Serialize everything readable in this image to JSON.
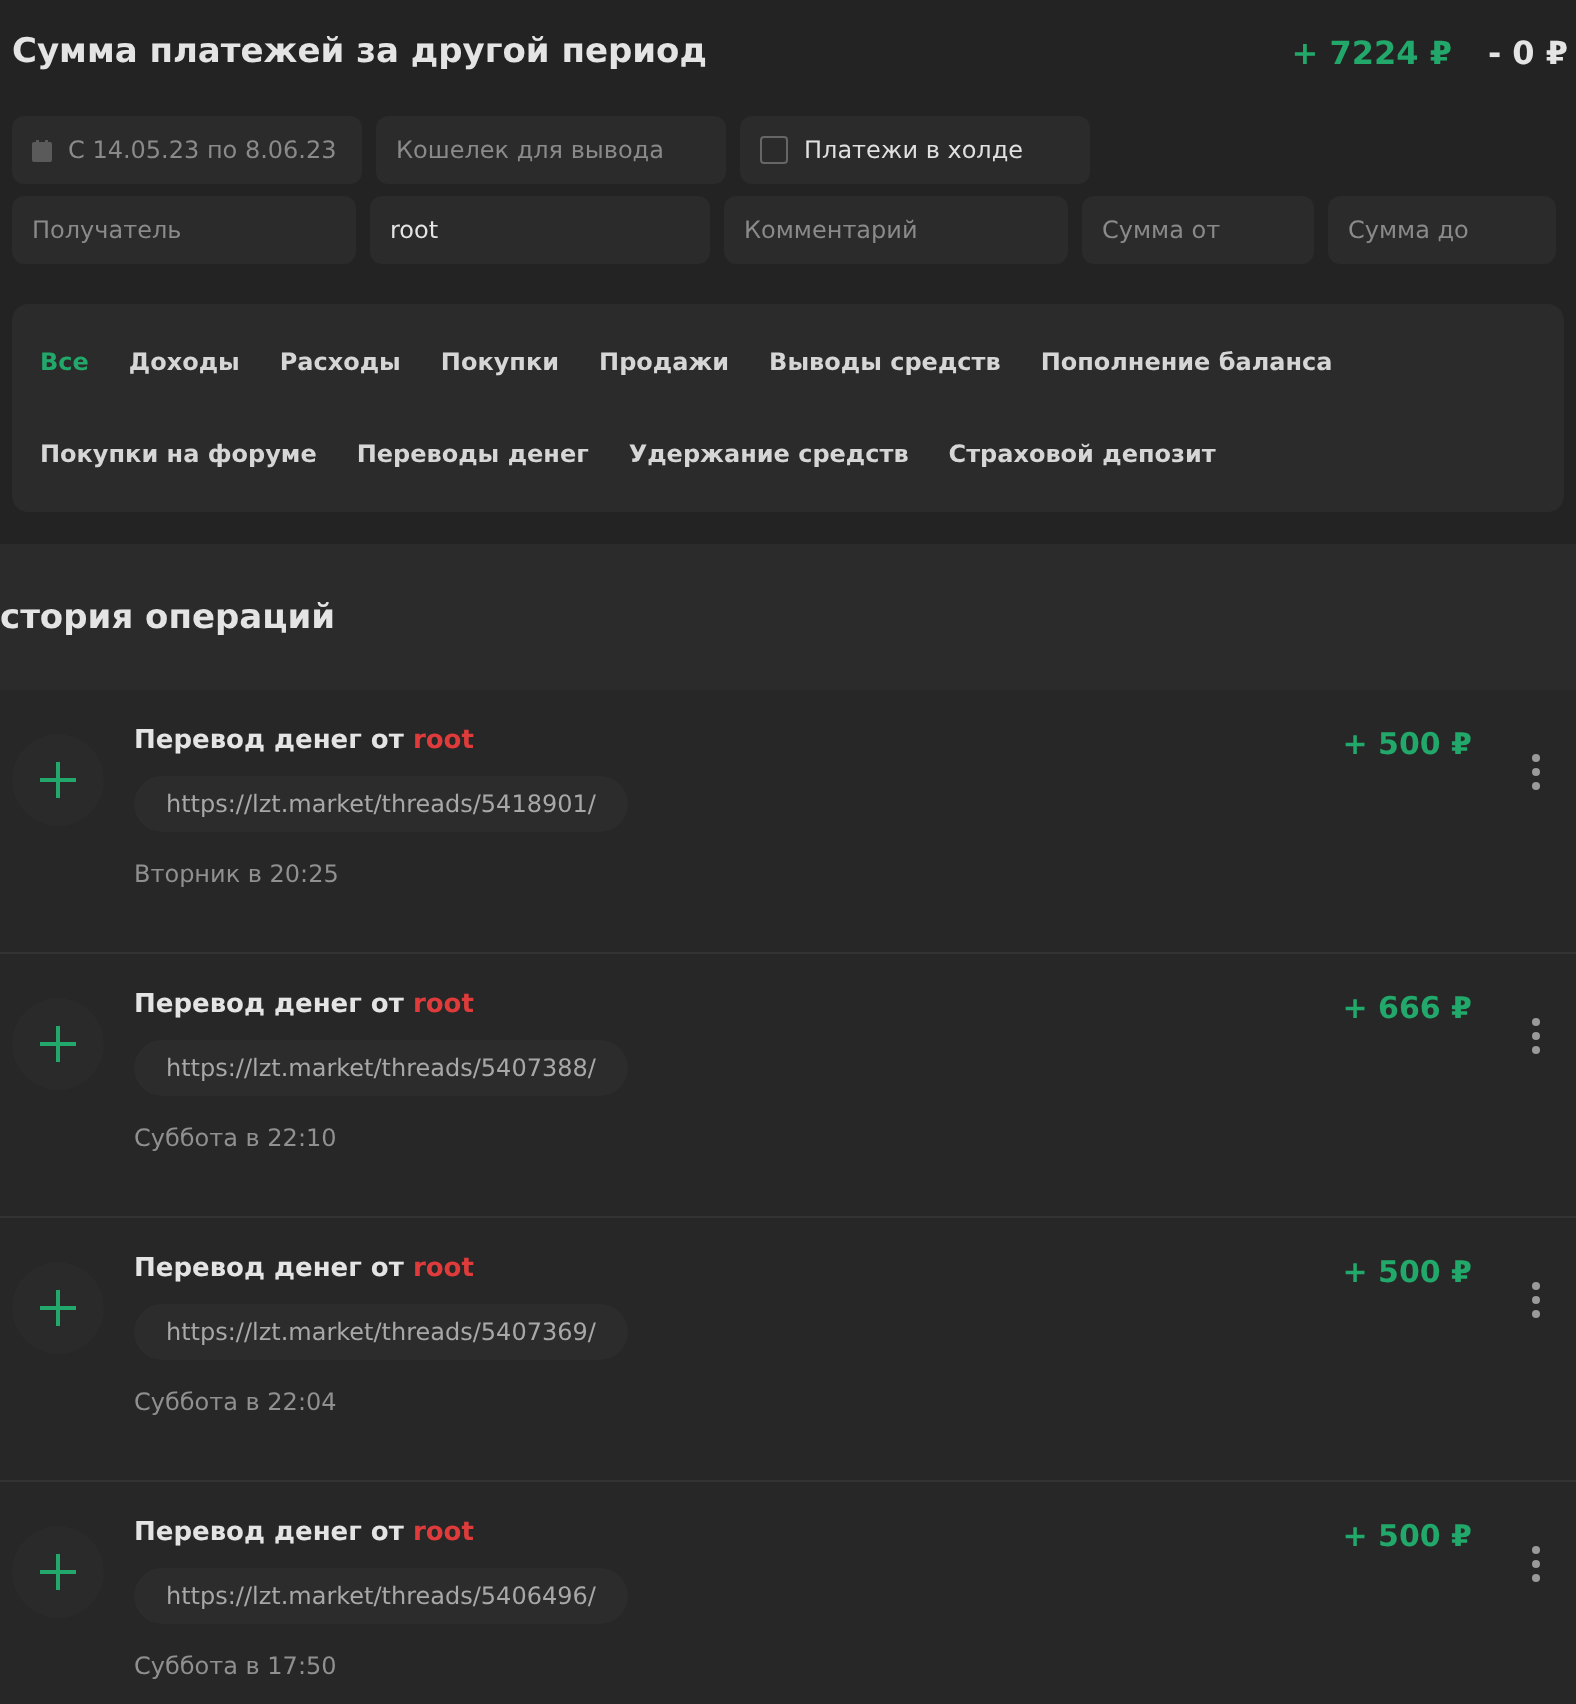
{
  "header": {
    "title": "Сумма платежей за другой период",
    "income": "+ 7224 ₽",
    "expense": "- 0 ₽"
  },
  "filters": {
    "date": "С 14.05.23 по 8.06.23",
    "wallet": {
      "placeholder": "Кошелек для вывода"
    },
    "hold": {
      "label": "Платежи в холде",
      "checked": false
    },
    "recipient": {
      "placeholder": "Получатель"
    },
    "user": {
      "value": "root"
    },
    "comment": {
      "placeholder": "Комментарий"
    },
    "sum_from": {
      "placeholder": "Сумма от"
    },
    "sum_to": {
      "placeholder": "Сумма до"
    }
  },
  "tabs": [
    {
      "label": "Все",
      "selected": true
    },
    {
      "label": "Доходы",
      "selected": false
    },
    {
      "label": "Расходы",
      "selected": false
    },
    {
      "label": "Покупки",
      "selected": false
    },
    {
      "label": "Продажи",
      "selected": false
    },
    {
      "label": "Выводы средств",
      "selected": false
    },
    {
      "label": "Пополнение баланса",
      "selected": false
    },
    {
      "label": "Покупки на форуме",
      "selected": false
    },
    {
      "label": "Переводы денег",
      "selected": false
    },
    {
      "label": "Удержание средств",
      "selected": false
    },
    {
      "label": "Страховой депозит",
      "selected": false
    }
  ],
  "history": {
    "title": "стория операций",
    "operations": [
      {
        "title": "Перевод денег от",
        "sender": "root",
        "link": "https://lzt.market/threads/5418901/",
        "time": "Вторник в 20:25",
        "amount": "+ 500 ₽"
      },
      {
        "title": "Перевод денег от",
        "sender": "root",
        "link": "https://lzt.market/threads/5407388/",
        "time": "Суббота в 22:10",
        "amount": "+ 666 ₽"
      },
      {
        "title": "Перевод денег от",
        "sender": "root",
        "link": "https://lzt.market/threads/5407369/",
        "time": "Суббота в 22:04",
        "amount": "+ 500 ₽"
      },
      {
        "title": "Перевод денег от",
        "sender": "root",
        "link": "https://lzt.market/threads/5406496/",
        "time": "Суббота в 17:50",
        "amount": "+ 500 ₽"
      }
    ]
  }
}
